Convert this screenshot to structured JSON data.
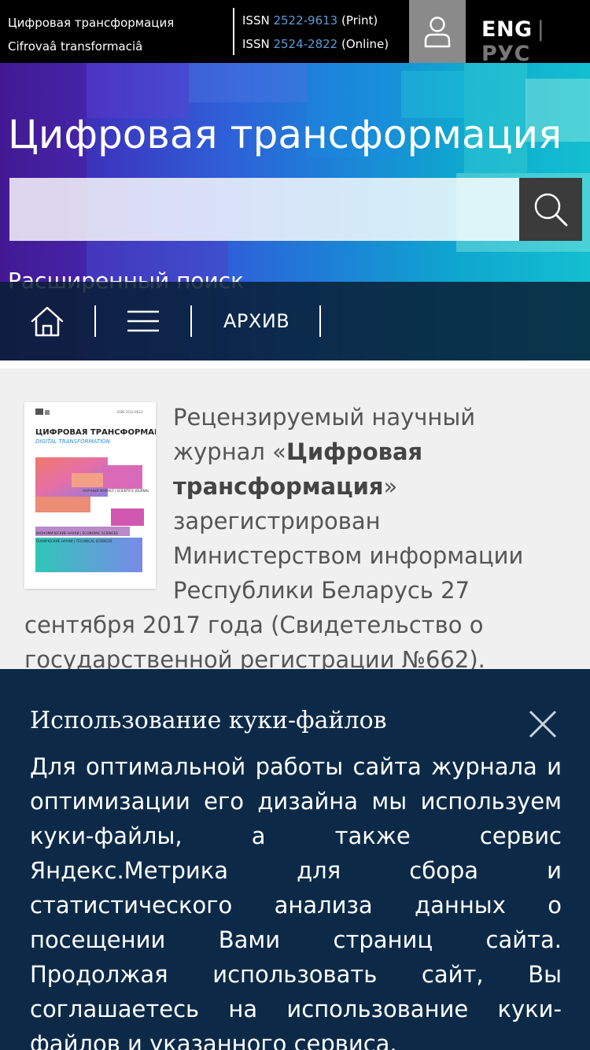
{
  "topbar": {
    "brand_ru": "Цифровая трансформация",
    "brand_translit": "Cifrovaâ transformaciâ",
    "issn_label": "ISSN",
    "issn_print": "2522-9613",
    "issn_print_note": "(Print)",
    "issn_online": "2524-2822",
    "issn_online_note": "(Online)",
    "user_icon": "user-icon",
    "lang_eng": "ENG",
    "lang_sep": "|",
    "lang_rus": "РУС"
  },
  "hero": {
    "title": "Цифровая трансформация",
    "search_placeholder": "",
    "search_icon": "search-icon",
    "advanced_search": "Расширенный поиск"
  },
  "nav": {
    "home_icon": "home-icon",
    "menu_icon": "hamburger-menu-icon",
    "archive_label": "АРХИВ"
  },
  "cover": {
    "issn": "ISSN 2522-9613",
    "title_ru": "ЦИФРОВАЯ ТРАНСФОРМАЦИЯ",
    "title_en": "DIGITAL TRANSFORMATION",
    "tag": "НАУЧНЫЙ ЖУРНАЛ | SCIENTIFIC JOURNAL",
    "line1": "ЭКОНОМИЧЕСКИЕ НАУКИ | ECONOMIC SCIENCES",
    "line2": "ТЕХНИЧЕСКИЕ НАУКИ | TECHNICAL SCIENCES"
  },
  "intro": {
    "text_a": "Рецензируемый научный журнал «",
    "journal_name": "Цифровая трансформация",
    "text_b": "» зарегистрирован Министерством информации Республики Беларусь 27 сентября 2017 года (Свидетельство о государственной регистрации №662). Территория распространения – Республика"
  },
  "cookie": {
    "title": "Использование куки-файлов",
    "close_icon": "close-icon",
    "text": "Для оптимальной работы сайта журнала и оптимизации его дизайна мы используем куки-файлы, а также сервис Яндекс.Метрика для сбора и статистического анализа данных о посещении Вами страниц сайта. Продолжая использовать сайт, Вы соглашаетесь на использование куки-файлов и указанного сервиса."
  },
  "colors": {
    "issn_link": "#5b9bd5",
    "navbar_bg": "#081e34",
    "cookie_bg": "#0c2a48",
    "user_btn_bg": "#8a8a8a"
  }
}
